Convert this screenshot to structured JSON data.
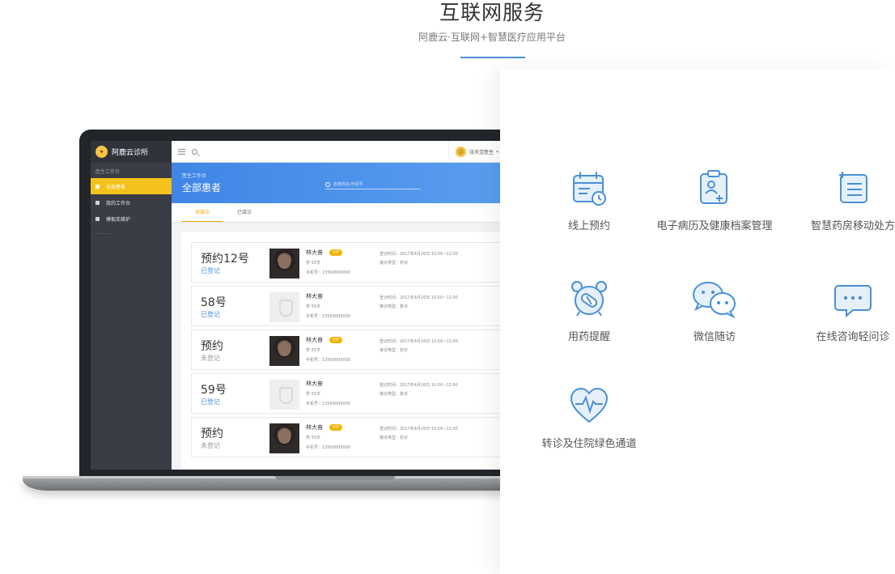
{
  "hero": {
    "title": "互联网服务",
    "subtitle": "阿鹿云·互联网+智慧医疗应用平台"
  },
  "app": {
    "brand": "阿鹿云诊所",
    "sidebar": {
      "section": "医生工作台",
      "items": [
        "全部患者",
        "我的工作台",
        "模板库维护"
      ]
    },
    "user": {
      "name": "张天宝医生",
      "caret": "▾"
    },
    "banner": {
      "crumb": "医生工作台",
      "title": "全部患者",
      "search_placeholder": "患者姓名/手机号"
    },
    "tabs": [
      "待接诊",
      "已接诊"
    ],
    "cards": [
      {
        "no": "预约12号",
        "status": "已登记",
        "status_type": "on",
        "name": "林大奋",
        "vip": "VIP",
        "gender_age": "男  55岁",
        "phone": "手机号：13560009000",
        "reg_time": "登记时间：2017年4月26日 10:00~12:00",
        "visit_type": "接诊类型：初诊",
        "photo": "real"
      },
      {
        "no": "58号",
        "status": "已登记",
        "status_type": "on",
        "name": "林大奋",
        "vip": "",
        "gender_age": "男  55岁",
        "phone": "手机号：13560009000",
        "reg_time": "登记时间：2017年4月26日 10:00~12:00",
        "visit_type": "接诊类型：复诊",
        "photo": "placeholder"
      },
      {
        "no": "预约",
        "status": "未登记",
        "status_type": "off",
        "name": "林大奋",
        "vip": "VIP",
        "gender_age": "男  55岁",
        "phone": "手机号：13560009000",
        "reg_time": "登记时间：2017年4月26日 10:00~12:00",
        "visit_type": "接诊类型：初诊",
        "photo": "real"
      },
      {
        "no": "59号",
        "status": "已登记",
        "status_type": "on",
        "name": "林大奋",
        "vip": "",
        "gender_age": "男  55岁",
        "phone": "手机号：13560009000",
        "reg_time": "登记时间：2017年4月26日 10:00~12:00",
        "visit_type": "接诊类型：复诊",
        "photo": "placeholder"
      },
      {
        "no": "预约",
        "status": "未登记",
        "status_type": "off",
        "name": "林大奋",
        "vip": "VIP",
        "gender_age": "男  55岁",
        "phone": "手机号：13560009000",
        "reg_time": "登记时间：2017年4月26日 10:00~12:00",
        "visit_type": "接诊类型：初诊",
        "photo": "real"
      }
    ]
  },
  "features": [
    {
      "label": "线上预约",
      "icon": "calendar-clock-icon"
    },
    {
      "label": "电子病历及健康档案管理",
      "icon": "medical-record-icon"
    },
    {
      "label": "智慧药房移动处方",
      "icon": "prescription-list-icon"
    },
    {
      "label": "用药提醒",
      "icon": "alarm-pill-icon"
    },
    {
      "label": "微信随访",
      "icon": "wechat-icon"
    },
    {
      "label": "在线咨询轻问诊",
      "icon": "chat-bubble-icon"
    },
    {
      "label": "转诊及住院绿色通道",
      "icon": "heart-pulse-icon"
    }
  ],
  "colors": {
    "accent": "#4a90d6",
    "sidebar": "#3a3d45",
    "active_item": "#f5c21b",
    "banner": "#3f86e6",
    "vip": "#f5b400"
  }
}
